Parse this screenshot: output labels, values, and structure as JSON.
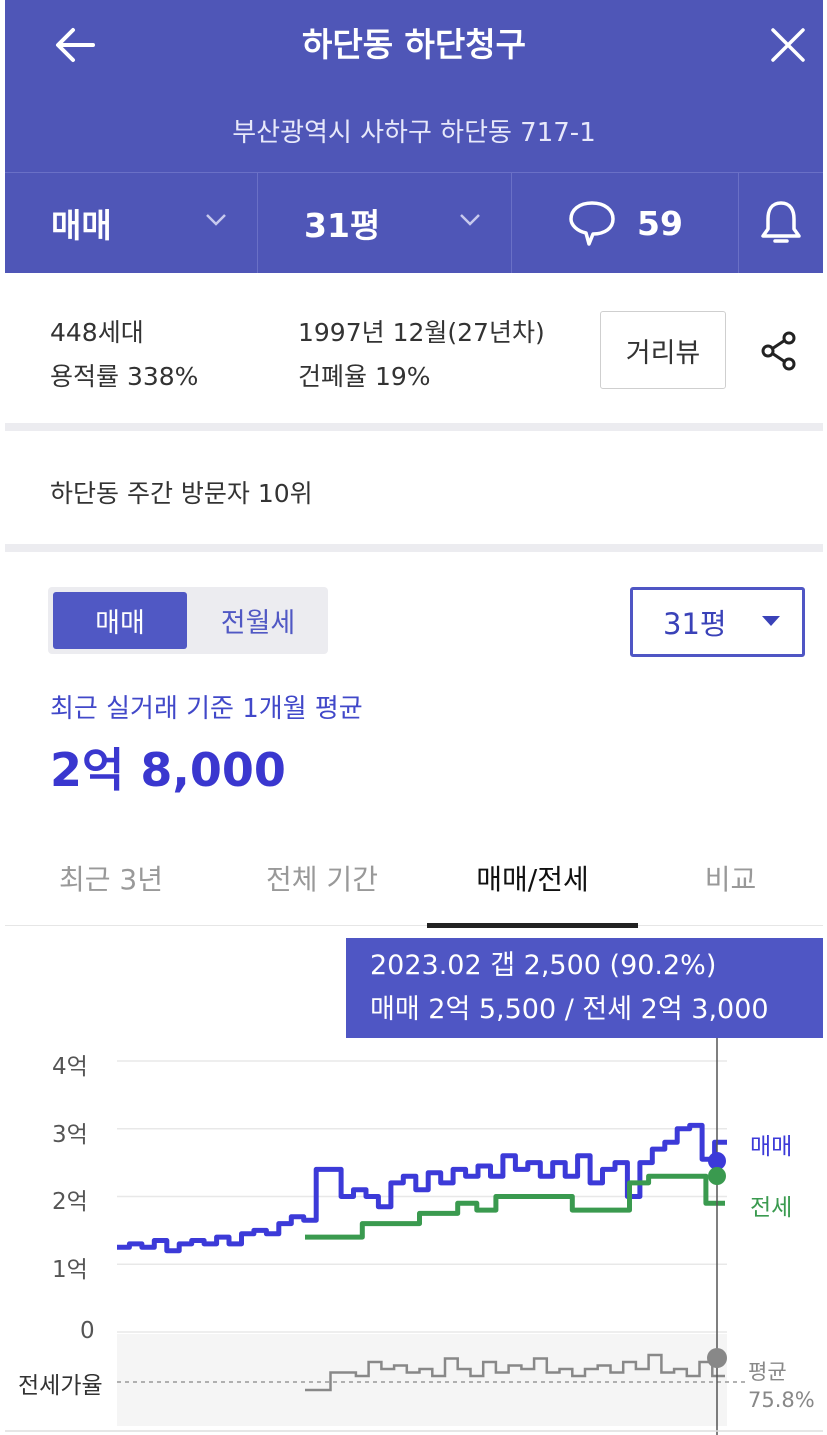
{
  "header": {
    "title": "하단동 하단청구",
    "address": "부산광역시 사하구 하단동 717-1",
    "deal_type": "매매",
    "size": "31평",
    "comment_count": "59"
  },
  "info": {
    "households": "448세대",
    "floor_area_ratio": "용적률 338%",
    "built": "1997년 12월(27년차)",
    "coverage_ratio": "건폐율 19%",
    "street_view_label": "거리뷰"
  },
  "rank_text": "하단동 주간 방문자 10위",
  "toggle": {
    "sale": "매매",
    "rent": "전월세"
  },
  "size_select": "31평",
  "avg": {
    "label": "최근 실거래 기준 1개월 평균",
    "price": "2억 8,000"
  },
  "tabs": [
    {
      "label": "최근 3년"
    },
    {
      "label": "전체 기간"
    },
    {
      "label": "매매/전세"
    },
    {
      "label": "비교"
    }
  ],
  "tooltip": {
    "line1": "2023.02  갭 2,500 (90.2%)",
    "line2": "매매 2억 5,500 / 전세 2억 3,000"
  },
  "chart_data": {
    "type": "line",
    "y_tick_labels": [
      "4억",
      "3억",
      "2억",
      "1억",
      "0"
    ],
    "ylim": [
      0,
      4
    ],
    "grid": true,
    "series": [
      {
        "name": "매매",
        "color": "#3c3ad8",
        "values": [
          1.25,
          1.3,
          1.25,
          1.35,
          1.2,
          1.3,
          1.35,
          1.3,
          1.4,
          1.3,
          1.45,
          1.5,
          1.45,
          1.6,
          1.7,
          1.65,
          2.4,
          2.4,
          2.0,
          2.1,
          2.0,
          1.85,
          2.2,
          2.3,
          2.1,
          2.35,
          2.2,
          2.4,
          2.3,
          2.45,
          2.3,
          2.6,
          2.4,
          2.5,
          2.3,
          2.5,
          2.3,
          2.6,
          2.2,
          2.4,
          2.5,
          2.0,
          2.5,
          2.7,
          2.8,
          3.0,
          3.05,
          2.55,
          2.8
        ]
      },
      {
        "name": "전세",
        "color": "#3a9a4f",
        "values": [
          1.4,
          1.4,
          1.4,
          1.6,
          1.6,
          1.6,
          1.75,
          1.75,
          1.9,
          1.8,
          2.0,
          2.0,
          2.0,
          2.0,
          1.8,
          1.8,
          1.8,
          2.2,
          2.3,
          2.3,
          2.3,
          1.9
        ]
      }
    ],
    "ratio_label": "전세가율",
    "ratio_avg_label": "평균",
    "ratio_avg_value": "75.8%"
  }
}
